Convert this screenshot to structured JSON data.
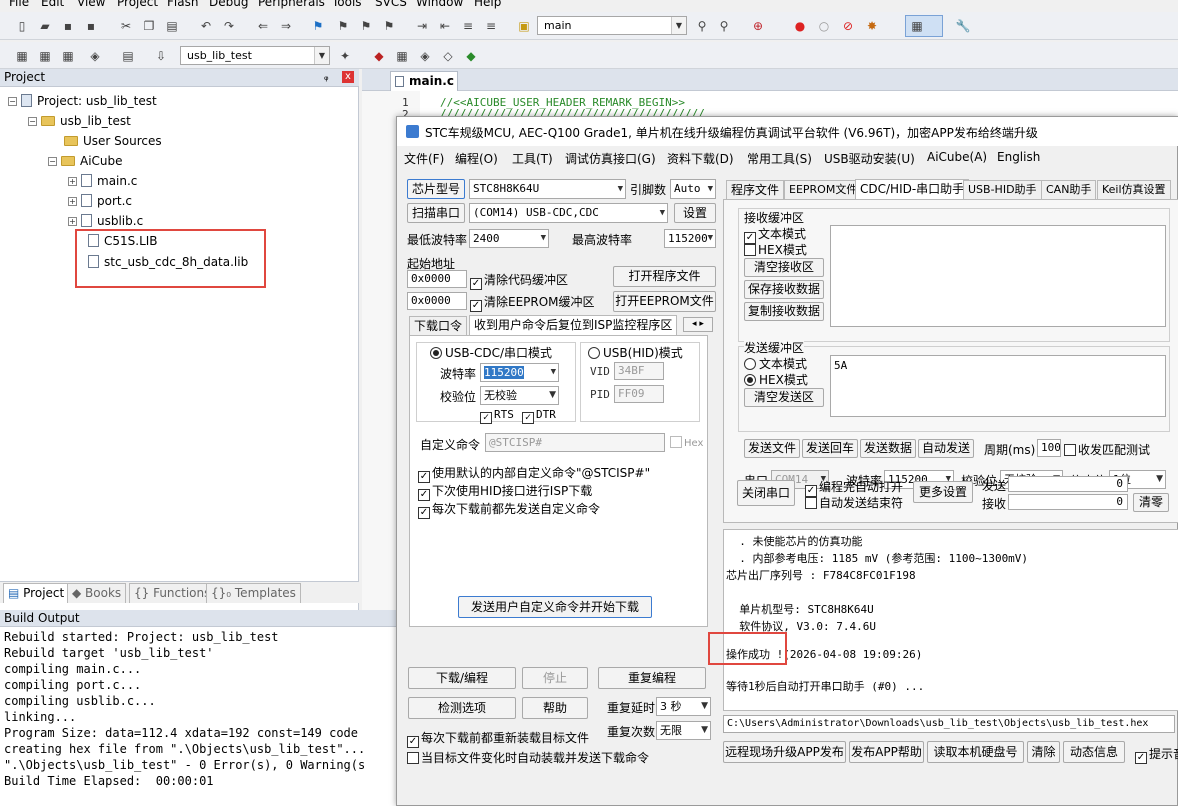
{
  "menu": [
    "File",
    "Edit",
    "View",
    "Project",
    "Flash",
    "Debug",
    "Peripherals",
    "Tools",
    "SVCS",
    "Window",
    "Help"
  ],
  "toolbar": {
    "find_value": "main",
    "target_value": "usb_lib_test"
  },
  "project_panel": {
    "title": "Project",
    "pin": "ᵩ",
    "close": "x",
    "tree": [
      {
        "label": "Project: usb_lib_test"
      },
      {
        "label": "usb_lib_test"
      },
      {
        "label": "User Sources"
      },
      {
        "label": "AiCube"
      },
      {
        "label": "main.c"
      },
      {
        "label": "port.c"
      },
      {
        "label": "usblib.c"
      },
      {
        "label": "C51S.LIB"
      },
      {
        "label": "stc_usb_cdc_8h_data.lib"
      }
    ],
    "tabs": [
      "Project",
      "Books",
      "{} Functions",
      "{}₀ Templates"
    ]
  },
  "build_output": {
    "title": "Build Output",
    "lines": [
      "Rebuild started: Project: usb_lib_test",
      "Rebuild target 'usb_lib_test'",
      "compiling main.c...",
      "compiling port.c...",
      "compiling usblib.c...",
      "linking...",
      "Program Size: data=112.4 xdata=192 const=149 code",
      "creating hex file from \".\\Objects\\usb_lib_test\"...",
      "\".\\Objects\\usb_lib_test\" - 0 Error(s), 0 Warning(s",
      "Build Time Elapsed:  00:00:01"
    ]
  },
  "editor": {
    "tab": "main.c",
    "line_numbers": [
      "1",
      "2"
    ],
    "line1": "//<<AICUBE_USER_HEADER_REMARK_BEGIN>>",
    "line2": "////////////////////////////////////////"
  },
  "stc": {
    "title": "STC车规级MCU, AEC-Q100 Grade1, 单片机在线升级编程仿真调试平台软件 (V6.96T)，加密APP发布给终端升级",
    "menu": [
      "文件(F)",
      "编程(O)",
      "工具(T)",
      "调试仿真接口(G)",
      "资料下载(D)",
      "常用工具(S)",
      "USB驱动安装(U)",
      "AiCube(A)",
      "English"
    ],
    "chip_btn": "芯片型号",
    "chip_value": "STC8H8K64U",
    "pins_label": "引脚数",
    "pins_value": "Auto",
    "scan_btn": "扫描串口",
    "port_value": "(COM14) USB-CDC,CDC",
    "settings_btn": "设置",
    "min_baud_label": "最低波特率",
    "min_baud": "2400",
    "max_baud_label": "最高波特率",
    "max_baud": "115200",
    "start_addr_label": "起始地址",
    "addr1": "0x0000",
    "clear_code": "清除代码缓冲区",
    "open_prog_btn": "打开程序文件",
    "addr2": "0x0000",
    "clear_eeprom": "清除EEPROM缓冲区",
    "open_eeprom_btn": "打开EEPROM文件",
    "left_tabs": [
      "下载口令",
      "收到用户命令后复位到ISP监控程序区"
    ],
    "usb_cdc_mode": "USB-CDC/串口模式",
    "usb_hid_mode": "USB(HID)模式",
    "baud_label": "波特率",
    "baud_value": "115200",
    "parity_label": "校验位",
    "parity_value": "无校验",
    "rts": "RTS",
    "dtr": "DTR",
    "vid_label": "VID",
    "vid_value": "34BF",
    "pid_label": "PID",
    "pid_value": "FF09",
    "custom_cmd_label": "自定义命令",
    "custom_cmd_value": "@STCISP#",
    "hex_label": "Hex",
    "opt1": "使用默认的内部自定义命令\"@STCISP#\"",
    "opt2": "下次使用HID接口进行ISP下载",
    "opt3": "每次下载前都先发送自定义命令",
    "send_start_btn": "发送用户自定义命令并开始下载",
    "download_btn": "下载/编程",
    "stop_btn": "停止",
    "reprog_btn": "重复编程",
    "check_btn": "检测选项",
    "help_btn": "帮助",
    "repeat_delay_label": "重复延时",
    "repeat_delay": "3 秒",
    "repeat_count_label": "重复次数",
    "repeat_count": "无限",
    "reload_chk": "每次下载前都重新装载目标文件",
    "auto_chk": "当目标文件变化时自动装载并发送下载命令",
    "right_tabs": [
      "程序文件",
      "EEPROM文件",
      "CDC/HID-串口助手",
      "USB-HID助手",
      "CAN助手",
      "Keil仿真设置"
    ],
    "recv_group": "接收缓冲区",
    "text_mode": "文本模式",
    "hex_mode": "HEX模式",
    "clear_recv": "清空接收区",
    "save_recv": "保存接收数据",
    "copy_recv": "复制接收数据",
    "send_group": "发送缓冲区",
    "send_text_mode": "文本模式",
    "send_hex_mode": "HEX模式",
    "clear_send": "清空发送区",
    "send_value": "5A",
    "send_file": "发送文件",
    "send_enter": "发送回车",
    "send_data": "发送数据",
    "auto_send": "自动发送",
    "period_label": "周期(ms)",
    "period_value": "100",
    "match_label": "收发匹配测试",
    "port_label": "串口",
    "port_sel": "COM14",
    "baud2_label": "波特率",
    "baud2": "115200",
    "parity2_label": "校验位",
    "parity2": "无校验",
    "stop_label": "停止位",
    "stop_value": "1位",
    "close_port": "关闭串口",
    "auto_open": "编程完自动打开",
    "auto_close": "自动发送结束符",
    "more_settings": "更多设置",
    "sent_label": "发送",
    "sent_value": "0",
    "recv_label": "接收",
    "recv_value": "0",
    "clear_count": "清零",
    "log": [
      "  . 未使能芯片的仿真功能",
      "  . 内部参考电压: 1185 mV (参考范围: 1100~1300mV)",
      "芯片出厂序列号 : F784C8FC01F198",
      "",
      "  单片机型号: STC8H8K64U",
      "  软件协议, V3.0: 7.4.6U",
      "",
      "操作成功 !(2026-04-08 19:09:26)",
      "",
      "等待1秒后自动打开串口助手 (#0) ..."
    ],
    "hex_path": "C:\\Users\\Administrator\\Downloads\\usb_lib_test\\Objects\\usb_lib_test.hex",
    "bottom_btns": [
      "远程现场升级APP发布",
      "发布APP帮助",
      "读取本机硬盘号",
      "清除",
      "动态信息"
    ],
    "prompt_chk": "提示音"
  }
}
